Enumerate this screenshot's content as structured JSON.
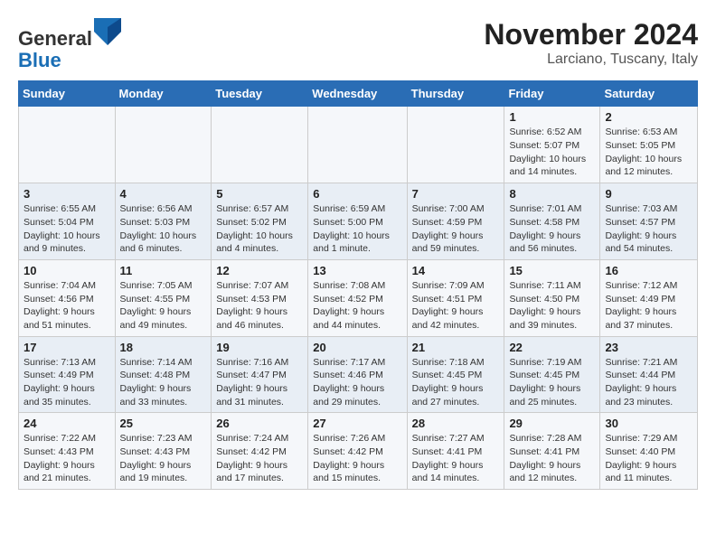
{
  "header": {
    "logo_general": "General",
    "logo_blue": "Blue",
    "month_title": "November 2024",
    "location": "Larciano, Tuscany, Italy"
  },
  "weekdays": [
    "Sunday",
    "Monday",
    "Tuesday",
    "Wednesday",
    "Thursday",
    "Friday",
    "Saturday"
  ],
  "weeks": [
    [
      {
        "day": "",
        "info": ""
      },
      {
        "day": "",
        "info": ""
      },
      {
        "day": "",
        "info": ""
      },
      {
        "day": "",
        "info": ""
      },
      {
        "day": "",
        "info": ""
      },
      {
        "day": "1",
        "info": "Sunrise: 6:52 AM\nSunset: 5:07 PM\nDaylight: 10 hours and 14 minutes."
      },
      {
        "day": "2",
        "info": "Sunrise: 6:53 AM\nSunset: 5:05 PM\nDaylight: 10 hours and 12 minutes."
      }
    ],
    [
      {
        "day": "3",
        "info": "Sunrise: 6:55 AM\nSunset: 5:04 PM\nDaylight: 10 hours and 9 minutes."
      },
      {
        "day": "4",
        "info": "Sunrise: 6:56 AM\nSunset: 5:03 PM\nDaylight: 10 hours and 6 minutes."
      },
      {
        "day": "5",
        "info": "Sunrise: 6:57 AM\nSunset: 5:02 PM\nDaylight: 10 hours and 4 minutes."
      },
      {
        "day": "6",
        "info": "Sunrise: 6:59 AM\nSunset: 5:00 PM\nDaylight: 10 hours and 1 minute."
      },
      {
        "day": "7",
        "info": "Sunrise: 7:00 AM\nSunset: 4:59 PM\nDaylight: 9 hours and 59 minutes."
      },
      {
        "day": "8",
        "info": "Sunrise: 7:01 AM\nSunset: 4:58 PM\nDaylight: 9 hours and 56 minutes."
      },
      {
        "day": "9",
        "info": "Sunrise: 7:03 AM\nSunset: 4:57 PM\nDaylight: 9 hours and 54 minutes."
      }
    ],
    [
      {
        "day": "10",
        "info": "Sunrise: 7:04 AM\nSunset: 4:56 PM\nDaylight: 9 hours and 51 minutes."
      },
      {
        "day": "11",
        "info": "Sunrise: 7:05 AM\nSunset: 4:55 PM\nDaylight: 9 hours and 49 minutes."
      },
      {
        "day": "12",
        "info": "Sunrise: 7:07 AM\nSunset: 4:53 PM\nDaylight: 9 hours and 46 minutes."
      },
      {
        "day": "13",
        "info": "Sunrise: 7:08 AM\nSunset: 4:52 PM\nDaylight: 9 hours and 44 minutes."
      },
      {
        "day": "14",
        "info": "Sunrise: 7:09 AM\nSunset: 4:51 PM\nDaylight: 9 hours and 42 minutes."
      },
      {
        "day": "15",
        "info": "Sunrise: 7:11 AM\nSunset: 4:50 PM\nDaylight: 9 hours and 39 minutes."
      },
      {
        "day": "16",
        "info": "Sunrise: 7:12 AM\nSunset: 4:49 PM\nDaylight: 9 hours and 37 minutes."
      }
    ],
    [
      {
        "day": "17",
        "info": "Sunrise: 7:13 AM\nSunset: 4:49 PM\nDaylight: 9 hours and 35 minutes."
      },
      {
        "day": "18",
        "info": "Sunrise: 7:14 AM\nSunset: 4:48 PM\nDaylight: 9 hours and 33 minutes."
      },
      {
        "day": "19",
        "info": "Sunrise: 7:16 AM\nSunset: 4:47 PM\nDaylight: 9 hours and 31 minutes."
      },
      {
        "day": "20",
        "info": "Sunrise: 7:17 AM\nSunset: 4:46 PM\nDaylight: 9 hours and 29 minutes."
      },
      {
        "day": "21",
        "info": "Sunrise: 7:18 AM\nSunset: 4:45 PM\nDaylight: 9 hours and 27 minutes."
      },
      {
        "day": "22",
        "info": "Sunrise: 7:19 AM\nSunset: 4:45 PM\nDaylight: 9 hours and 25 minutes."
      },
      {
        "day": "23",
        "info": "Sunrise: 7:21 AM\nSunset: 4:44 PM\nDaylight: 9 hours and 23 minutes."
      }
    ],
    [
      {
        "day": "24",
        "info": "Sunrise: 7:22 AM\nSunset: 4:43 PM\nDaylight: 9 hours and 21 minutes."
      },
      {
        "day": "25",
        "info": "Sunrise: 7:23 AM\nSunset: 4:43 PM\nDaylight: 9 hours and 19 minutes."
      },
      {
        "day": "26",
        "info": "Sunrise: 7:24 AM\nSunset: 4:42 PM\nDaylight: 9 hours and 17 minutes."
      },
      {
        "day": "27",
        "info": "Sunrise: 7:26 AM\nSunset: 4:42 PM\nDaylight: 9 hours and 15 minutes."
      },
      {
        "day": "28",
        "info": "Sunrise: 7:27 AM\nSunset: 4:41 PM\nDaylight: 9 hours and 14 minutes."
      },
      {
        "day": "29",
        "info": "Sunrise: 7:28 AM\nSunset: 4:41 PM\nDaylight: 9 hours and 12 minutes."
      },
      {
        "day": "30",
        "info": "Sunrise: 7:29 AM\nSunset: 4:40 PM\nDaylight: 9 hours and 11 minutes."
      }
    ]
  ]
}
